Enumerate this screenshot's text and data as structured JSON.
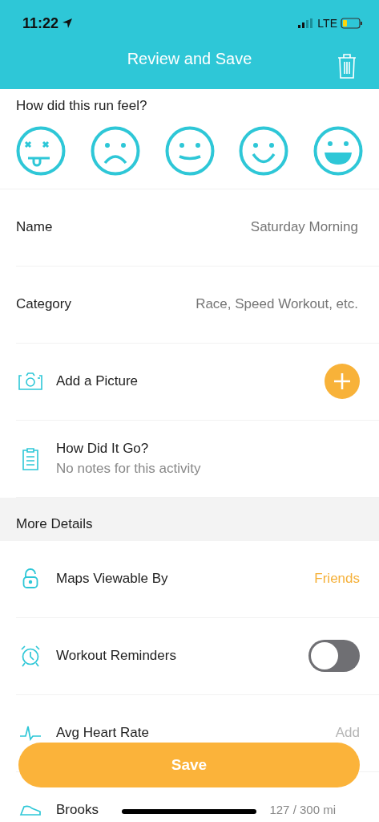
{
  "status_bar": {
    "time": "11:22",
    "network": "LTE"
  },
  "header": {
    "title": "Review and Save"
  },
  "feel": {
    "question": "How did this run feel?",
    "faces": [
      {
        "kind": "dead"
      },
      {
        "kind": "sad"
      },
      {
        "kind": "neutral"
      },
      {
        "kind": "smile"
      },
      {
        "kind": "laugh"
      }
    ]
  },
  "rows": [
    {
      "kind": "field",
      "label": "Name",
      "placeholder": "Saturday Morning"
    },
    {
      "kind": "field",
      "label": "Category",
      "placeholder": "Race, Speed Workout, etc."
    },
    {
      "kind": "add",
      "label": "Add a Picture"
    },
    {
      "kind": "note",
      "label": "How Did It Go?",
      "subtitle": "No notes for this activity"
    }
  ],
  "more_details": {
    "title": "More Details",
    "rows": [
      {
        "kind": "value",
        "label": "Maps Viewable By",
        "value": "Friends",
        "muted": false
      },
      {
        "kind": "toggle",
        "label": "Workout Reminders",
        "on": false
      },
      {
        "kind": "value",
        "label": "Avg Heart Rate",
        "value": "Add",
        "muted": true
      },
      {
        "kind": "shoe",
        "label": "Brooks",
        "value": "127 / 300 mi"
      }
    ]
  },
  "save_button": "Save"
}
